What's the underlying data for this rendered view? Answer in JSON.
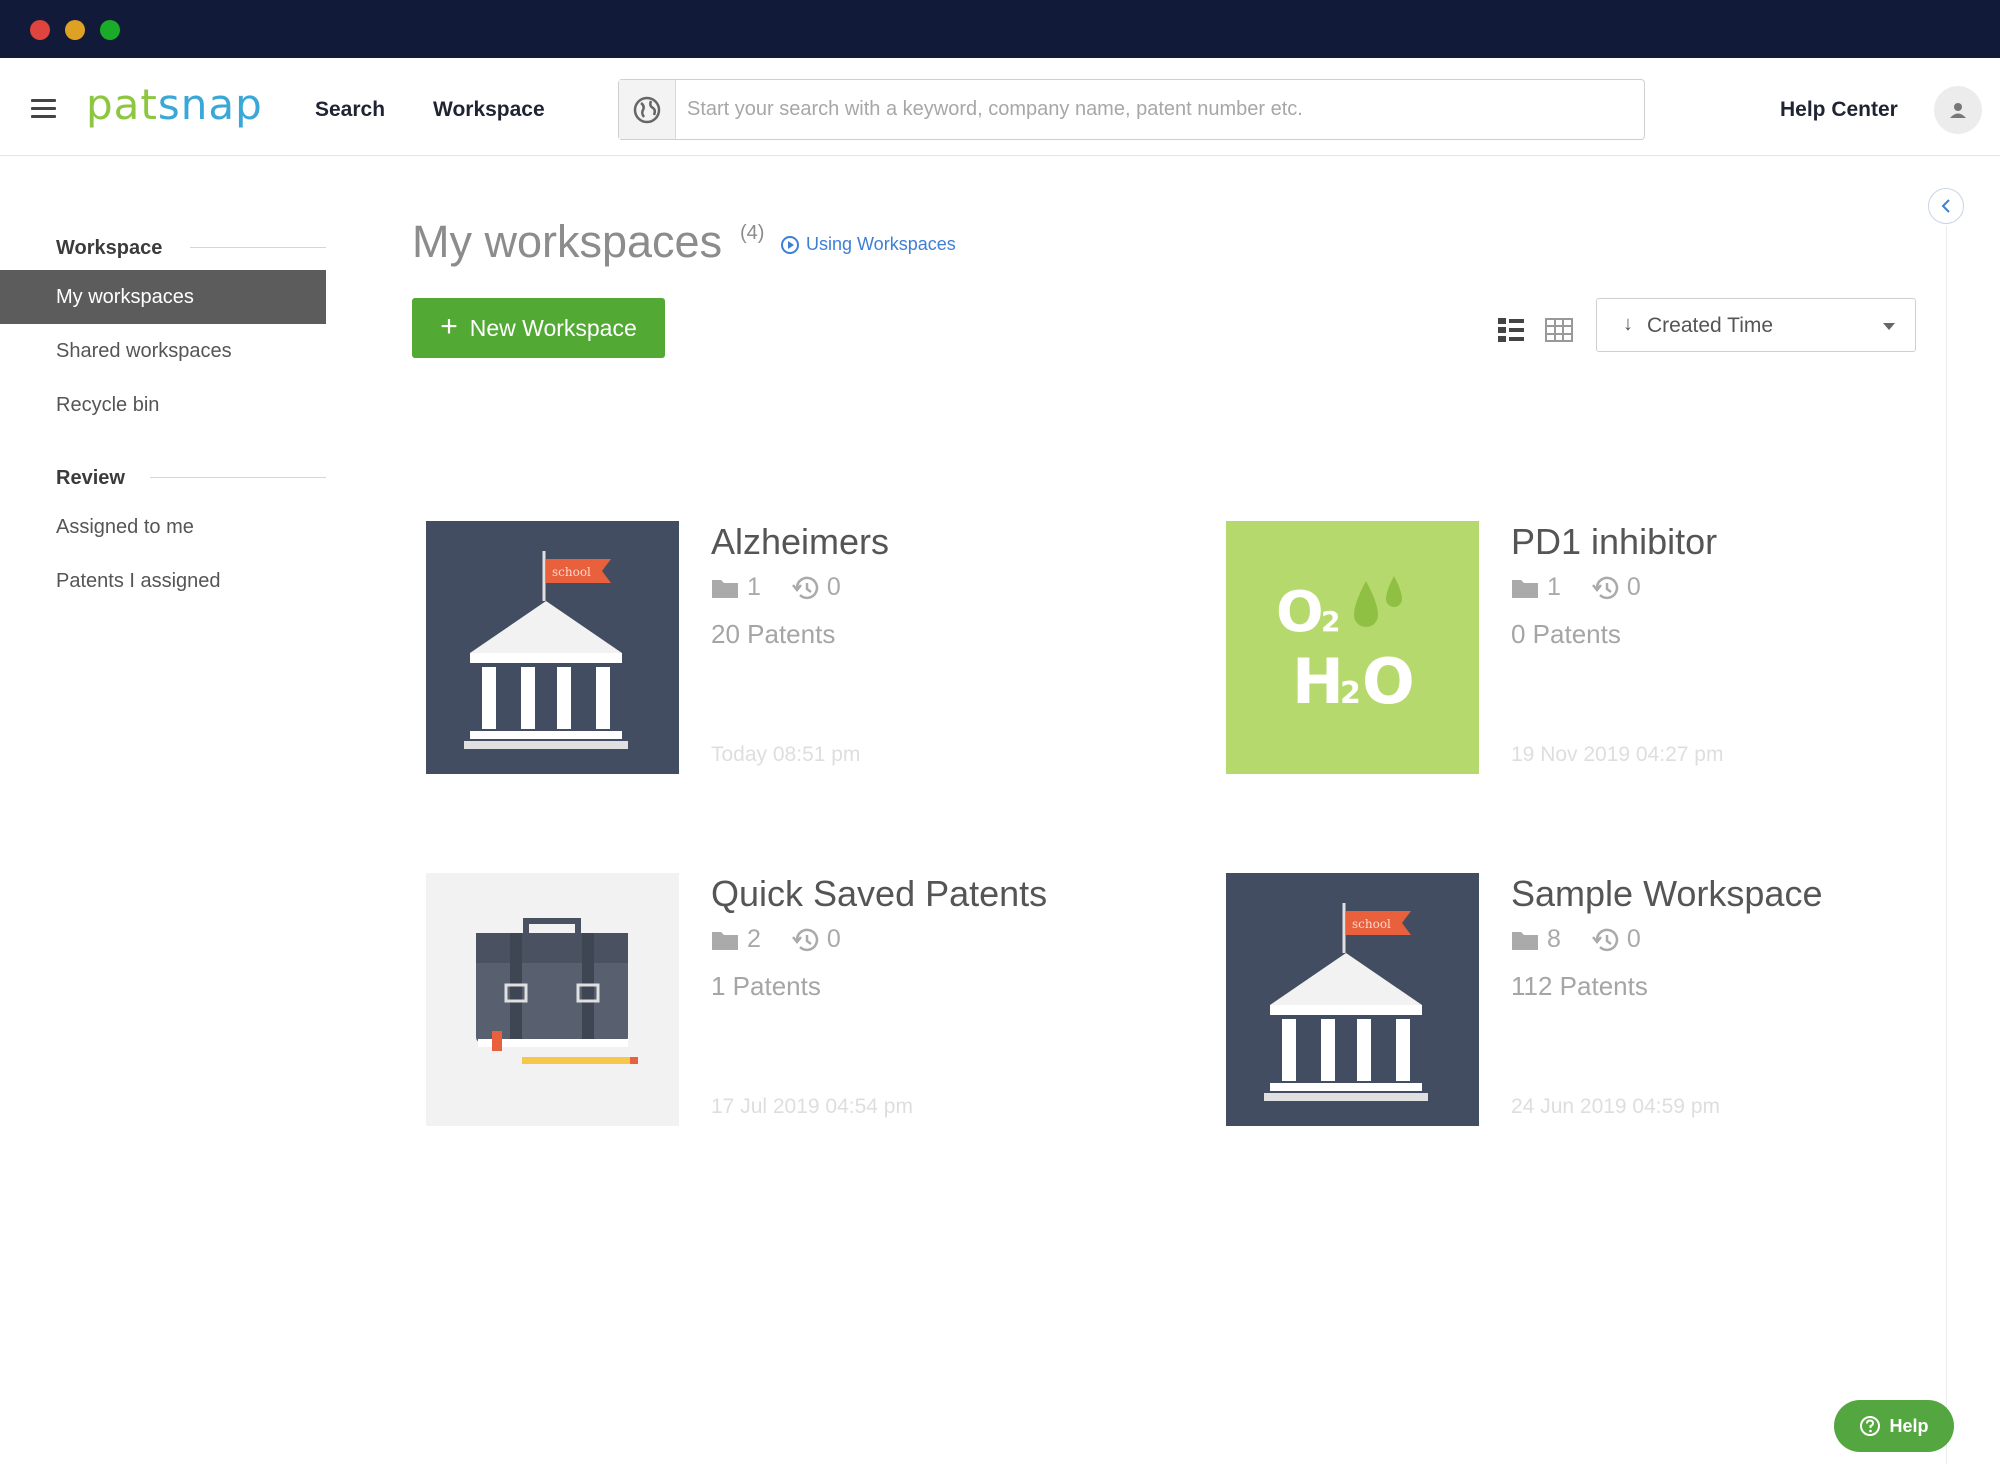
{
  "window": {
    "controls": [
      "close",
      "minimize",
      "maximize"
    ]
  },
  "header": {
    "logo_text_1": "pat",
    "logo_text_2": "snap",
    "nav": [
      {
        "label": "Search"
      },
      {
        "label": "Workspace"
      }
    ],
    "search_placeholder": "Start your search with a keyword, company name, patent number etc.",
    "help_center": "Help Center",
    "icons": {
      "menu": "hamburger-icon",
      "globe": "globe-icon",
      "avatar": "user-icon"
    }
  },
  "sidebar": {
    "sections": [
      {
        "title": "Workspace",
        "items": [
          "My workspaces",
          "Shared workspaces",
          "Recycle bin"
        ]
      },
      {
        "title": "Review",
        "items": [
          "Assigned to me",
          "Patents I assigned"
        ]
      }
    ],
    "active_item": "My workspaces"
  },
  "main": {
    "title": "My workspaces",
    "count": "(4)",
    "using_link": "Using Workspaces",
    "new_button": "New Workspace",
    "sort": {
      "label": "Created Time",
      "arrow": "↓"
    },
    "views": [
      "list-view-icon",
      "grid-view-icon"
    ]
  },
  "workspaces": [
    {
      "name": "Alzheimers",
      "folders": "1",
      "history": "0",
      "patents": "20 Patents",
      "date": "Today 08:51 pm",
      "thumb": "school-building",
      "flag_text": "school"
    },
    {
      "name": "PD1 inhibitor",
      "folders": "1",
      "history": "0",
      "patents": "0 Patents",
      "date": "19 Nov 2019 04:27 pm",
      "thumb": "o2-h2o",
      "o": "O",
      "o_sub": "2",
      "h": "H",
      "h_sub": "2",
      "h_o": "O"
    },
    {
      "name": "Quick Saved Patents",
      "folders": "2",
      "history": "0",
      "patents": "1 Patents",
      "date": "17 Jul 2019 04:54 pm",
      "thumb": "briefcase"
    },
    {
      "name": "Sample Workspace",
      "folders": "8",
      "history": "0",
      "patents": "112 Patents",
      "date": "24 Jun 2019 04:59 pm",
      "thumb": "school-building",
      "flag_text": "school"
    }
  ],
  "help_button": "Help",
  "colors": {
    "accent_green": "#52aa35",
    "titlebar": "#111a38",
    "link_blue": "#3d7fd6",
    "thumb_slate": "#434d62",
    "thumb_lime": "#b6d96d"
  }
}
